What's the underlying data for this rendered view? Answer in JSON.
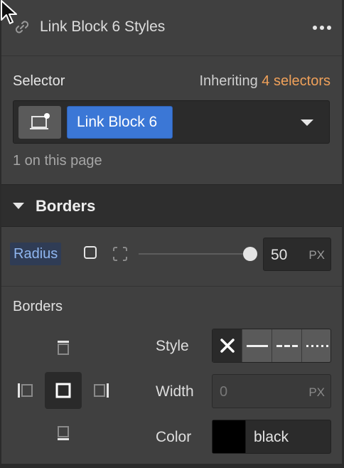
{
  "header": {
    "title": "Link Block 6 Styles",
    "icon": "link-icon",
    "menu_icon": "more-horizontal-icon"
  },
  "selector": {
    "label": "Selector",
    "inheriting_prefix": "Inheriting",
    "inheriting_count": "4 selectors",
    "chip_label": "Link Block 6",
    "state_icon": "element-state-icon",
    "on_page": "1 on this page"
  },
  "borders_section": {
    "title": "Borders",
    "radius": {
      "label": "Radius",
      "value": "50",
      "unit": "PX",
      "slider_fraction": 1.0
    },
    "borders_label": "Borders",
    "style": {
      "label": "Style",
      "options": [
        "none",
        "solid",
        "dashed",
        "dotted"
      ],
      "selected": "none"
    },
    "width": {
      "label": "Width",
      "placeholder": "0",
      "unit": "PX"
    },
    "color": {
      "label": "Color",
      "value": "black",
      "swatch": "#000000"
    }
  },
  "colors": {
    "accent": "#3b77d6",
    "orange": "#f0a15a",
    "radius_label": "#8fb6f0"
  }
}
